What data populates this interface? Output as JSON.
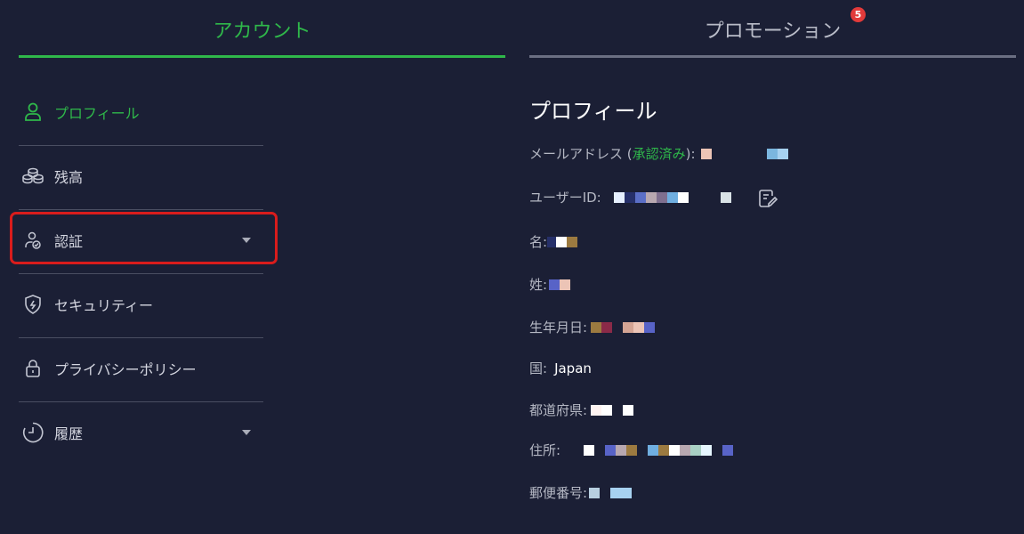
{
  "tabs": {
    "account": "アカウント",
    "promotion": "プロモーション",
    "promotion_badge": "5"
  },
  "sidebar": {
    "items": [
      {
        "label": "プロフィール",
        "icon": "user-icon"
      },
      {
        "label": "残高",
        "icon": "coins-icon"
      },
      {
        "label": "認証",
        "icon": "user-check-icon"
      },
      {
        "label": "セキュリティー",
        "icon": "shield-icon"
      },
      {
        "label": "プライバシーポリシー",
        "icon": "lock-icon"
      },
      {
        "label": "履歴",
        "icon": "clock-icon"
      }
    ]
  },
  "profile": {
    "title": "プロフィール",
    "email_label": "メールアドレス (",
    "email_verified": "承認済み",
    "email_label_end": "):",
    "userid_label": "ユーザーID:",
    "firstname_label": "名:",
    "lastname_label": "姓:",
    "birthdate_label": "生年月日:",
    "country_label": "国:",
    "country_value": "Japan",
    "prefecture_label": "都道府県:",
    "address_label": "住所:",
    "postal_label": "郵便番号:"
  },
  "colors": {
    "accent": "#2fb84a",
    "background": "#1b1f35",
    "highlight": "#d91c1c",
    "badge": "#e23a3a"
  }
}
